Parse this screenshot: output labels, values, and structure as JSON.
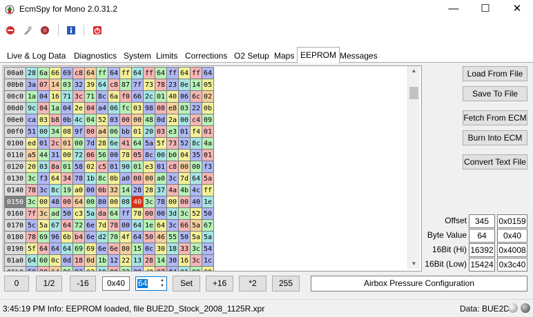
{
  "window": {
    "title": "EcmSpy for Mono 2.0.31.2",
    "minimize": "—",
    "maximize": "☐",
    "close": "✕"
  },
  "toolbar": {
    "icons": [
      "connect-icon",
      "tools-icon",
      "record-icon",
      "info-icon",
      "power-icon"
    ]
  },
  "tabs": [
    "Live & Log Data",
    "Diagnostics",
    "System",
    "Limits",
    "Corrections",
    "O2 Setup",
    "Maps",
    "EEPROM",
    "Messages"
  ],
  "active_tab": "EEPROM",
  "hex": {
    "rows": [
      {
        "addr": "00a0",
        "cells": [
          "28",
          "6a",
          "66",
          "69",
          "c8",
          "64",
          "ff",
          "64",
          "ff",
          "64",
          "ff",
          "64",
          "ff",
          "64",
          "ff",
          "64"
        ]
      },
      {
        "addr": "00b0",
        "cells": [
          "3a",
          "07",
          "14",
          "03",
          "32",
          "39",
          "64",
          "c8",
          "87",
          "7f",
          "73",
          "78",
          "23",
          "0e",
          "14",
          "05"
        ]
      },
      {
        "addr": "00c0",
        "cells": [
          "1a",
          "04",
          "16",
          "71",
          "3c",
          "71",
          "8c",
          "6a",
          "f0",
          "66",
          "2c",
          "01",
          "40",
          "06",
          "6c",
          "02"
        ]
      },
      {
        "addr": "00d0",
        "cells": [
          "9c",
          "04",
          "1a",
          "04",
          "2e",
          "04",
          "a4",
          "06",
          "fc",
          "03",
          "98",
          "08",
          "e8",
          "03",
          "22",
          "0b"
        ]
      },
      {
        "addr": "00e0",
        "cells": [
          "ca",
          "03",
          "b8",
          "0b",
          "4c",
          "04",
          "52",
          "03",
          "00",
          "00",
          "48",
          "0d",
          "2a",
          "00",
          "c4",
          "09"
        ]
      },
      {
        "addr": "00f0",
        "cells": [
          "51",
          "00",
          "34",
          "08",
          "9f",
          "00",
          "a4",
          "06",
          "bb",
          "01",
          "20",
          "03",
          "e3",
          "01",
          "f4",
          "01"
        ]
      },
      {
        "addr": "0100",
        "cells": [
          "ed",
          "01",
          "2c",
          "01",
          "00",
          "7d",
          "28",
          "6e",
          "41",
          "64",
          "5a",
          "5f",
          "73",
          "52",
          "8c",
          "4a"
        ]
      },
      {
        "addr": "0110",
        "cells": [
          "a5",
          "44",
          "31",
          "00",
          "72",
          "06",
          "56",
          "00",
          "78",
          "05",
          "8c",
          "00",
          "b0",
          "04",
          "35",
          "01"
        ]
      },
      {
        "addr": "0120",
        "cells": [
          "20",
          "03",
          "8a",
          "01",
          "58",
          "02",
          "c5",
          "01",
          "90",
          "01",
          "e3",
          "01",
          "c8",
          "00",
          "00",
          "f3"
        ]
      },
      {
        "addr": "0130",
        "cells": [
          "3c",
          "f3",
          "64",
          "34",
          "78",
          "1b",
          "8c",
          "0b",
          "a0",
          "00",
          "00",
          "a0",
          "3c",
          "7d",
          "64",
          "5a"
        ]
      },
      {
        "addr": "0140",
        "cells": [
          "78",
          "3c",
          "8c",
          "19",
          "a0",
          "00",
          "0b",
          "32",
          "14",
          "28",
          "28",
          "37",
          "4a",
          "4b",
          "4c",
          "ff"
        ]
      },
      {
        "addr": "0150",
        "cells": [
          "3c",
          "00",
          "48",
          "00",
          "64",
          "00",
          "80",
          "00",
          "08",
          "40",
          "3c",
          "78",
          "00",
          "00",
          "40",
          "1e"
        ]
      },
      {
        "addr": "0160",
        "cells": [
          "7f",
          "3c",
          "ad",
          "50",
          "c3",
          "5a",
          "da",
          "64",
          "ff",
          "78",
          "00",
          "00",
          "3d",
          "3c",
          "52",
          "50"
        ]
      },
      {
        "addr": "0170",
        "cells": [
          "5c",
          "5a",
          "67",
          "64",
          "72",
          "6e",
          "7d",
          "78",
          "00",
          "64",
          "1e",
          "64",
          "3c",
          "66",
          "5a",
          "67"
        ]
      },
      {
        "addr": "0180",
        "cells": [
          "78",
          "69",
          "96",
          "6b",
          "b4",
          "6e",
          "d2",
          "70",
          "4f",
          "64",
          "50",
          "46",
          "55",
          "50",
          "5a",
          "5a"
        ]
      },
      {
        "addr": "0190",
        "cells": [
          "5f",
          "64",
          "64",
          "64",
          "69",
          "69",
          "6e",
          "6e",
          "80",
          "15",
          "0c",
          "30",
          "18",
          "33",
          "3c",
          "54"
        ]
      },
      {
        "addr": "01a0",
        "cells": [
          "64",
          "60",
          "0c",
          "0d",
          "18",
          "0d",
          "1b",
          "12",
          "22",
          "13",
          "28",
          "14",
          "30",
          "16",
          "3c",
          "1c"
        ]
      },
      {
        "addr": "01b0",
        "cells": [
          "50",
          "20",
          "64",
          "26",
          "03",
          "03",
          "19",
          "00",
          "32",
          "00",
          "d0",
          "07",
          "f4",
          "01",
          "00",
          "00"
        ]
      },
      {
        "addr": "01c0",
        "cells": [
          "00",
          "00",
          "00",
          "00",
          "00",
          "00",
          "00",
          "00",
          "00",
          "00",
          "00",
          "00",
          "00",
          "00",
          "00",
          "00"
        ]
      }
    ],
    "selected_addr": "0150",
    "selected_col": 9
  },
  "side_buttons": {
    "load": "Load From File",
    "save": "Save To File",
    "fetch": "Fetch From ECM",
    "burn": "Burn Into ECM",
    "convert": "Convert Text File"
  },
  "info": {
    "offset_label": "Offset",
    "offset_dec": "345",
    "offset_hex": "0x0159",
    "byte_label": "Byte Value",
    "byte_dec": "64",
    "byte_hex": "0x40",
    "hi_label": "16Bit (Hi)",
    "hi_dec": "16392",
    "hi_hex": "0x4008",
    "low_label": "16Bit (Low)",
    "low_dec": "15424",
    "low_hex": "0x3c40"
  },
  "bottom": {
    "btn0": "0",
    "btn_half": "1/2",
    "btn_m16": "-16",
    "hex_field": "0x40",
    "spin_value": "64",
    "set": "Set",
    "btn_p16": "+16",
    "btn_x2": "*2",
    "btn_255": "255",
    "config_name": "Airbox Pressure Configuration"
  },
  "status": {
    "message": "3:45:19 PM Info: EEPROM loaded, file BUE2D_Stock_2008_1125R.xpr",
    "data": "Data: BUE2D"
  },
  "colors": {
    "pink": "#f4b6b6",
    "yellow": "#f4f09a",
    "green": "#b8f0b8",
    "blue": "#b0b8f4",
    "teal": "#a8e4e4",
    "orange": "#f4d0a0",
    "selected": "#e03010"
  }
}
